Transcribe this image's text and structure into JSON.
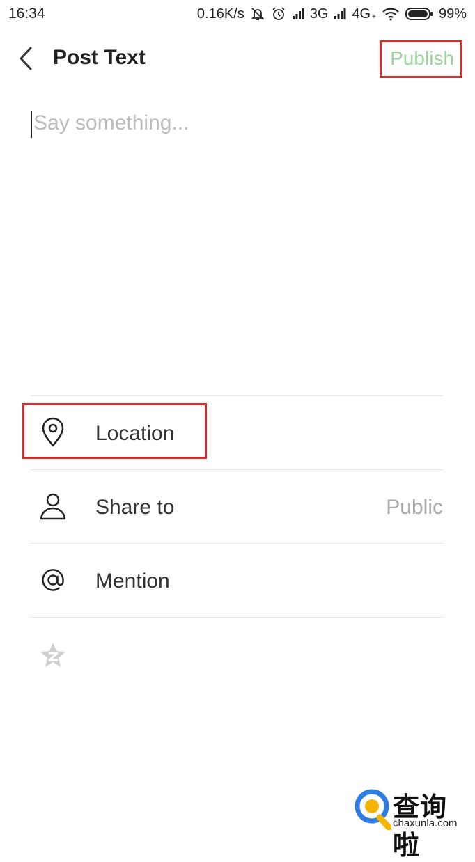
{
  "status_bar": {
    "time": "16:34",
    "net_speed": "0.16K/s",
    "net1": "3G",
    "net2": "4G",
    "net2_sub": "+",
    "battery": "99%",
    "icons": [
      "mute-bell-icon",
      "alarm-icon",
      "signal-icon",
      "wifi-icon",
      "battery-icon"
    ]
  },
  "header": {
    "title": "Post Text",
    "publish_label": "Publish",
    "publish_color": "#9bd49b"
  },
  "compose": {
    "placeholder": "Say something..."
  },
  "menu": {
    "items": [
      {
        "label": "Location",
        "icon": "location-pin-icon"
      },
      {
        "label": "Share to",
        "value": "Public",
        "icon": "person-icon"
      },
      {
        "label": "Mention",
        "icon": "at-icon"
      },
      {
        "icon": "qzone-star-icon"
      }
    ]
  },
  "annotations": {
    "color": "#d32f2f"
  },
  "watermark": {
    "name": "查询啦",
    "url": "chaxunla.com"
  }
}
